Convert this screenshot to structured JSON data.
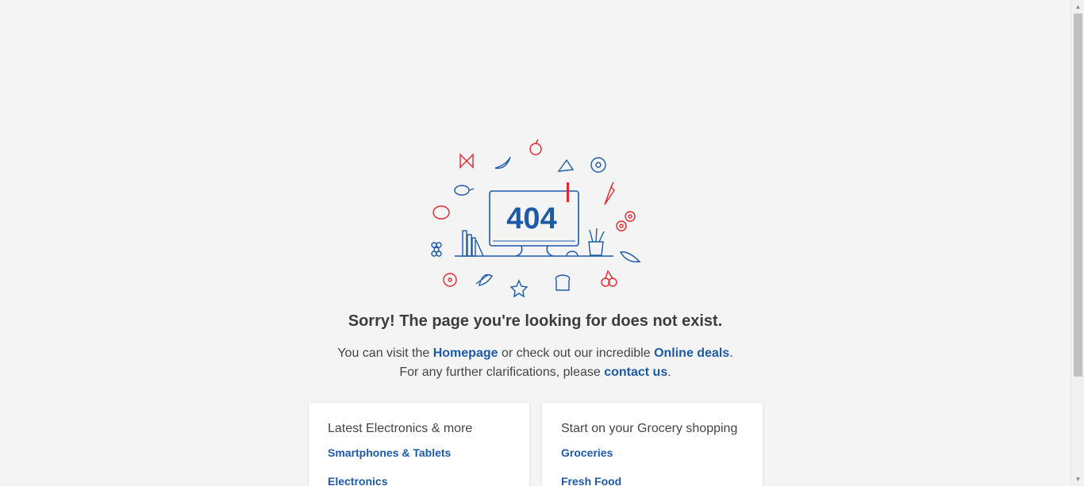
{
  "error": {
    "code": "404",
    "title": "Sorry! The page you're looking for does not exist.",
    "line1_pre": "You can visit the ",
    "homepage_link": "Homepage",
    "line1_mid": " or check out our incredible ",
    "deals_link": "Online deals",
    "line1_post": ".",
    "line2_pre": "For any further clarifications, please ",
    "contact_link": "contact us",
    "line2_post": "."
  },
  "cards": [
    {
      "title": "Latest Electronics & more",
      "links": [
        "Smartphones & Tablets",
        "Electronics"
      ]
    },
    {
      "title": "Start on your Grocery shopping",
      "links": [
        "Groceries",
        "Fresh Food"
      ]
    }
  ],
  "colors": {
    "accent_blue": "#1d5aa8",
    "accent_red": "#e3262f",
    "background": "#f4f4f4"
  },
  "icons": [
    "apple-icon",
    "pasta-icon",
    "banana-icon",
    "cheese-icon",
    "donut-icon",
    "chicken-leg-icon",
    "carrot-icon",
    "steak-icon",
    "flower-icon",
    "grapes-icon",
    "leaf-icon",
    "tomato-icon",
    "fish-icon",
    "star-icon",
    "bread-icon",
    "cherries-icon",
    "monitor-icon",
    "books-icon",
    "plant-pot-icon",
    "mouse-icon"
  ]
}
